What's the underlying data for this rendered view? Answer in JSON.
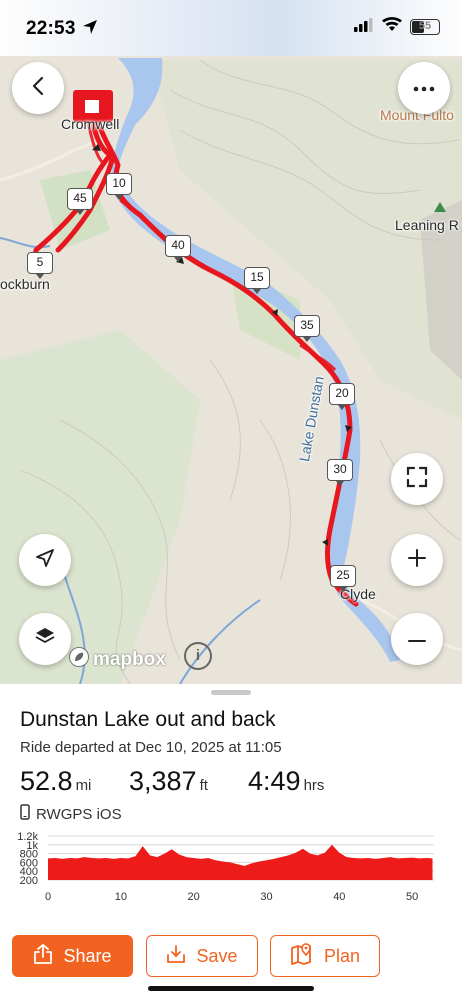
{
  "status_bar": {
    "time": "22:53",
    "battery": "55"
  },
  "map": {
    "labels": {
      "cromwell": "Cromwell",
      "bannockburn": "ockburn",
      "mount_fulton": "Mount Fulto",
      "leaning_rock": "Leaning R",
      "lake_dunstan": "Lake Dunstan",
      "clyde": "Clyde"
    },
    "km_markers": [
      "5",
      "45",
      "10",
      "40",
      "15",
      "35",
      "20",
      "30",
      "25"
    ],
    "attribution": "mapbox",
    "info_icon": "i",
    "route_color": "#e8161e",
    "water_color": "#a9c6ee",
    "icons": {
      "back": "chevron-left-icon",
      "more": "more-horizontal-icon",
      "fullscreen": "fullscreen-icon",
      "zoom_in": "plus-icon",
      "zoom_out": "minus-icon",
      "locate": "location-arrow-icon",
      "layers": "layers-icon"
    }
  },
  "route": {
    "title": "Dunstan Lake out and back",
    "subtitle": "Ride departed at Dec 10, 2025 at 11:05",
    "distance": {
      "value": "52.8",
      "unit": "mi"
    },
    "elevation": {
      "value": "3,387",
      "unit": "ft"
    },
    "duration": {
      "value": "4:49",
      "unit": "hrs"
    },
    "device": "RWGPS iOS"
  },
  "chart_data": {
    "type": "area",
    "title": "",
    "xlabel": "",
    "ylabel": "",
    "y_ticks": [
      "1.2k",
      "1k",
      "800",
      "600",
      "400",
      "200"
    ],
    "x_ticks": [
      "0",
      "10",
      "20",
      "30",
      "40",
      "50"
    ],
    "ylim": [
      200,
      1200
    ],
    "xlim": [
      0,
      53
    ],
    "fill_color": "#ee1b1b",
    "grid": true,
    "x": [
      0,
      1,
      2,
      3,
      4,
      5,
      6,
      7,
      8,
      9,
      10,
      11,
      12,
      13,
      14,
      15,
      16,
      17,
      18,
      19,
      20,
      21,
      22,
      23,
      24,
      25,
      26,
      27,
      28,
      29,
      30,
      31,
      32,
      33,
      34,
      35,
      36,
      37,
      38,
      39,
      40,
      41,
      42,
      43,
      44,
      45,
      46,
      47,
      48,
      49,
      50,
      51,
      52,
      52.8
    ],
    "y": [
      690,
      700,
      680,
      700,
      690,
      720,
      700,
      690,
      700,
      680,
      700,
      690,
      740,
      970,
      760,
      720,
      800,
      900,
      780,
      720,
      700,
      680,
      700,
      650,
      620,
      600,
      560,
      520,
      580,
      620,
      650,
      680,
      720,
      760,
      820,
      910,
      800,
      760,
      820,
      1000,
      820,
      720,
      700,
      690,
      700,
      680,
      700,
      720,
      690,
      700,
      710,
      690,
      700,
      690
    ]
  },
  "actions": {
    "share": "Share",
    "save": "Save",
    "plan": "Plan"
  }
}
